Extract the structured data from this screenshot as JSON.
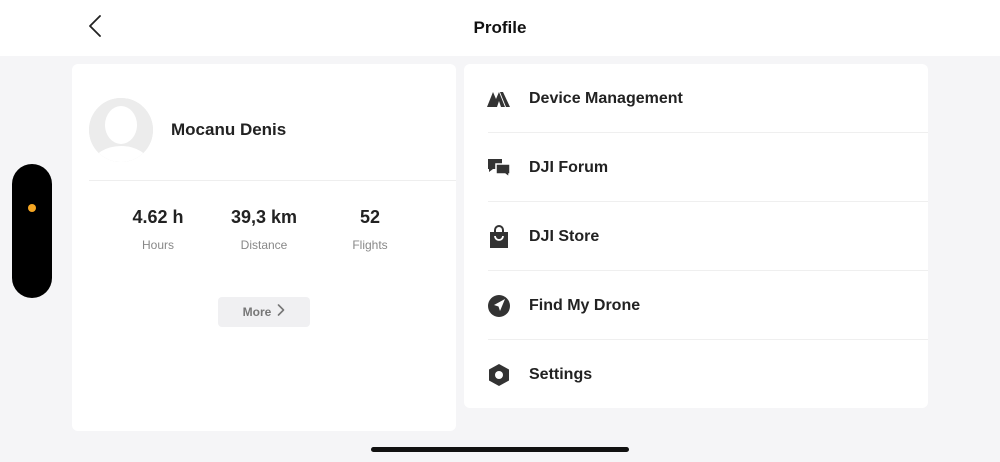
{
  "header": {
    "title": "Profile",
    "back_icon": "chevron-left-icon"
  },
  "profile": {
    "name": "Mocanu Denis",
    "avatar_icon": "user-avatar-placeholder",
    "stats": [
      {
        "value": "4.62 h",
        "label": "Hours"
      },
      {
        "value": "39,3 km",
        "label": "Distance"
      },
      {
        "value": "52",
        "label": "Flights"
      }
    ],
    "more_label": "More"
  },
  "menu": {
    "items": [
      {
        "label": "Device Management",
        "icon": "device-management-icon"
      },
      {
        "label": "DJI Forum",
        "icon": "forum-icon"
      },
      {
        "label": "DJI Store",
        "icon": "store-bag-icon"
      },
      {
        "label": "Find My Drone",
        "icon": "find-drone-icon"
      },
      {
        "label": "Settings",
        "icon": "settings-hexagon-icon"
      }
    ]
  },
  "colors": {
    "background": "#f5f5f7",
    "card": "#ffffff",
    "accent_dot": "#f5a623",
    "text_primary": "#222222",
    "text_secondary": "#888888"
  }
}
